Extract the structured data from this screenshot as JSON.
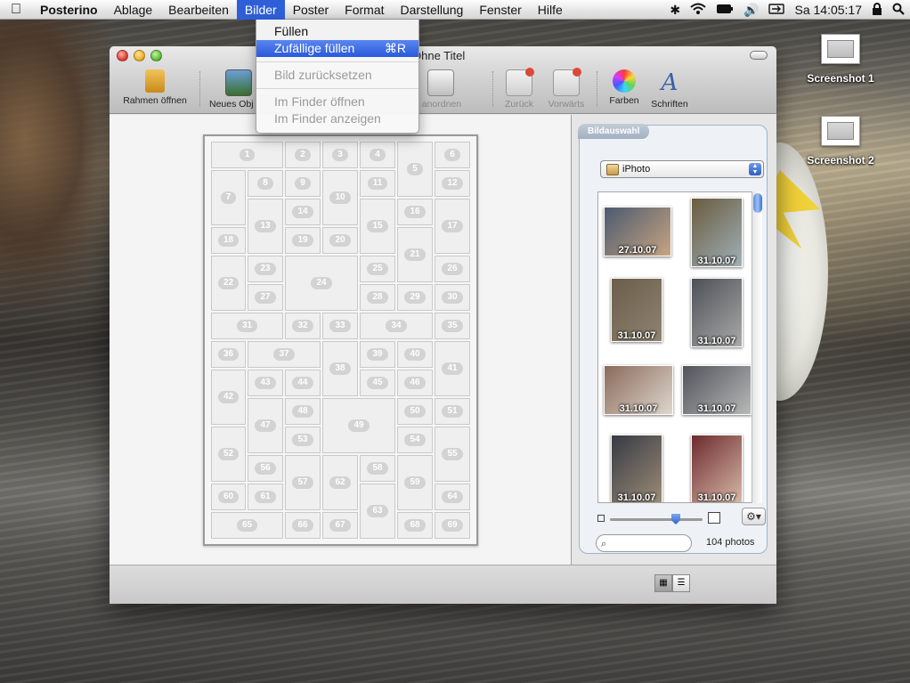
{
  "menubar": {
    "apple": "",
    "items": [
      "Posterino",
      "Ablage",
      "Bearbeiten",
      "Bilder",
      "Poster",
      "Format",
      "Darstellung",
      "Fenster",
      "Hilfe"
    ],
    "clock": "Sa 14:05:17"
  },
  "bilder_menu": {
    "fill": "Füllen",
    "random_fill": "Zufällige füllen",
    "random_fill_shortcut": "⌘R",
    "reset_image": "Bild zurücksetzen",
    "open_finder": "Im Finder öffnen",
    "show_finder": "Im Finder anzeigen"
  },
  "window": {
    "title": "Ohne Titel",
    "toolbar": {
      "open_frame": "Rahmen öffnen",
      "new_object": "Neues Obj",
      "arrange": "llig anordnen",
      "back": "Zurück",
      "forward": "Vorwärts",
      "colors": "Farben",
      "fonts": "Schriften"
    }
  },
  "poster": {
    "cells": [
      "1",
      "2",
      "3",
      "4",
      "5",
      "6",
      "7",
      "8",
      "9",
      "10",
      "11",
      "12",
      "13",
      "14",
      "15",
      "16",
      "17",
      "18",
      "19",
      "20",
      "21",
      "22",
      "23",
      "24",
      "25",
      "26",
      "27",
      "28",
      "29",
      "30",
      "31",
      "32",
      "33",
      "34",
      "35",
      "36",
      "37",
      "38",
      "39",
      "40",
      "41",
      "42",
      "43",
      "44",
      "45",
      "46",
      "47",
      "48",
      "49",
      "50",
      "51",
      "52",
      "53",
      "54",
      "55",
      "56",
      "57",
      "58",
      "59",
      "60",
      "61",
      "62",
      "63",
      "64",
      "65",
      "66",
      "67",
      "68",
      "69"
    ]
  },
  "browser": {
    "tab_label": "Bildauswahl",
    "source": "iPhoto",
    "photos": [
      {
        "date": "27.10.07",
        "colors": [
          "#4b5a6e",
          "#c7a482"
        ]
      },
      {
        "date": "31.10.07",
        "colors": [
          "#6a5b3e",
          "#9fb0b8"
        ]
      },
      {
        "date": "31.10.07",
        "colors": [
          "#6b5e4b",
          "#8e8371"
        ]
      },
      {
        "date": "31.10.07",
        "colors": [
          "#4d5057",
          "#a9aaa8"
        ]
      },
      {
        "date": "31.10.07",
        "colors": [
          "#8a6b5b",
          "#dfd6cd"
        ]
      },
      {
        "date": "31.10.07",
        "colors": [
          "#50535a",
          "#b7b9b8"
        ]
      },
      {
        "date": "31.10.07",
        "colors": [
          "#363a44",
          "#9c8c76"
        ]
      },
      {
        "date": "31.10.07",
        "colors": [
          "#6d2a2e",
          "#d7b9a7"
        ]
      }
    ],
    "photo_count": "104 photos",
    "search_placeholder": ""
  },
  "desktop": {
    "icons": [
      "Screenshot 1",
      "Screenshot 2"
    ]
  }
}
